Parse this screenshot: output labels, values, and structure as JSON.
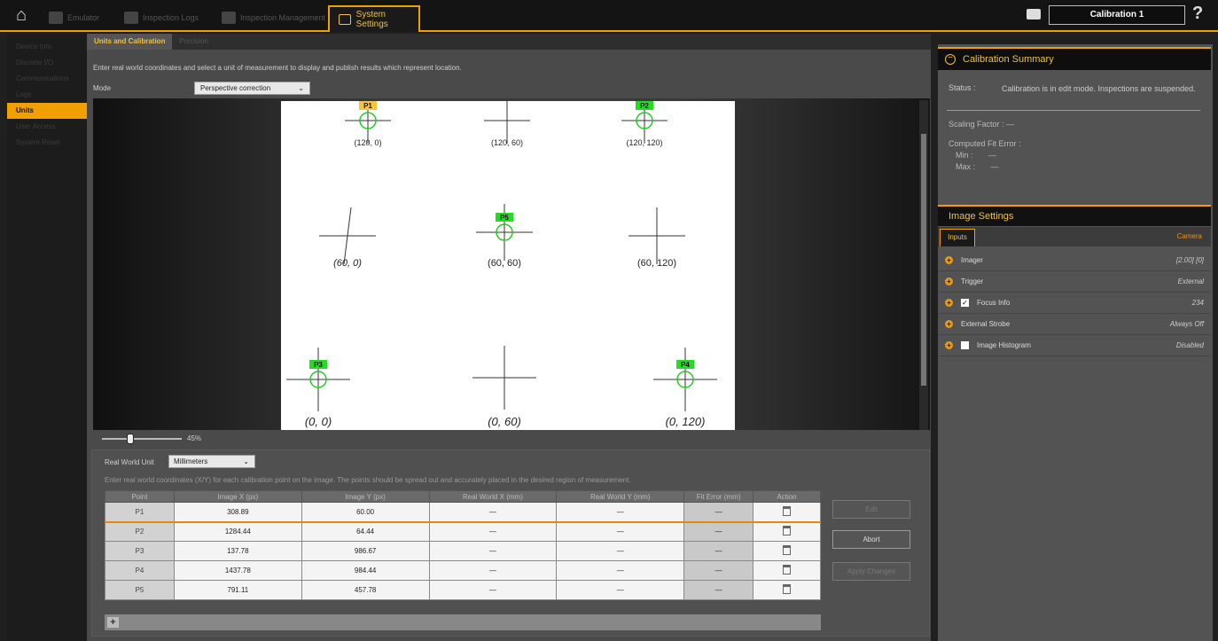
{
  "topbar": {
    "nav": [
      "Emulator",
      "Inspection Logs",
      "Inspection Management"
    ],
    "active_tab": "System Settings",
    "calibration_name": "Calibration 1",
    "help": "?"
  },
  "sidebar": {
    "items": [
      {
        "label": "Device Info"
      },
      {
        "label": "Discrete I/O"
      },
      {
        "label": "Communications"
      },
      {
        "label": "Logs"
      },
      {
        "label": "Units"
      },
      {
        "label": "User Access"
      },
      {
        "label": "System Reset"
      }
    ]
  },
  "main": {
    "tabs": [
      "Units and Calibration",
      "Precision"
    ],
    "instruction": "Enter real world coordinates and select a unit of measurement to display and publish results which represent location.",
    "mode_label": "Mode",
    "mode_value": "Perspective correction",
    "zoom": "45%"
  },
  "calibration_image": {
    "markers": [
      {
        "tag": "P1",
        "coord": "(120, 0)",
        "tag_color": "#f5c542"
      },
      {
        "tag": "",
        "coord": "(120, 60)"
      },
      {
        "tag": "P2",
        "coord": "(120, 120)",
        "tag_color": "#22dd22"
      },
      {
        "tag": "",
        "coord": "(60, 0)"
      },
      {
        "tag": "P5",
        "coord": "(60, 60)",
        "tag_color": "#22dd22"
      },
      {
        "tag": "",
        "coord": "(60, 120)"
      },
      {
        "tag": "P3",
        "coord": "(0, 0)",
        "tag_color": "#22dd22"
      },
      {
        "tag": "",
        "coord": "(0, 60)"
      },
      {
        "tag": "P4",
        "coord": "(0, 120)",
        "tag_color": "#22dd22"
      }
    ]
  },
  "bottom": {
    "unit_label": "Real World Unit",
    "unit_value": "Millimeters",
    "instruction": "Enter real world coordinates (X/Y) for each calibration point on the image. The points should be spread out and accurately placed in the desired region of measurement.",
    "columns": [
      "Point",
      "Image X (px)",
      "Image Y (px)",
      "Real World X (mm)",
      "Real World Y (mm)",
      "Fit Error (mm)",
      "Action"
    ],
    "rows": [
      {
        "point": "P1",
        "ix": "308.89",
        "iy": "60.00",
        "rx": "—",
        "ry": "—",
        "fit": "—"
      },
      {
        "point": "P2",
        "ix": "1284.44",
        "iy": "64.44",
        "rx": "—",
        "ry": "—",
        "fit": "—"
      },
      {
        "point": "P3",
        "ix": "137.78",
        "iy": "986.67",
        "rx": "—",
        "ry": "—",
        "fit": "—"
      },
      {
        "point": "P4",
        "ix": "1437.78",
        "iy": "984.44",
        "rx": "—",
        "ry": "—",
        "fit": "—"
      },
      {
        "point": "P5",
        "ix": "791.11",
        "iy": "457.78",
        "rx": "—",
        "ry": "—",
        "fit": "—"
      }
    ],
    "add_button": "+",
    "edit_button": "Edit",
    "abort_button": "Abort",
    "apply_button": "Apply Changes"
  },
  "calibration_summary": {
    "title": "Calibration Summary",
    "status_label": "Status :",
    "status_text": "Calibration is in edit mode. Inspections are suspended.",
    "scaling": "Scaling Factor : —",
    "fit_error_label": "Computed Fit Error :",
    "min": "Min :       —",
    "max": "Max :       —"
  },
  "image_settings": {
    "title": "Image Settings",
    "tab_inputs": "Inputs",
    "tab_camera": "Camera",
    "rows": [
      {
        "label": "Imager",
        "value": "[2.00] [0]",
        "checkbox": null
      },
      {
        "label": "Trigger",
        "value": "External",
        "checkbox": null
      },
      {
        "label": "Focus Info",
        "value": "234",
        "checkbox": true
      },
      {
        "label": "External Strobe",
        "value": "Always Off",
        "checkbox": null
      },
      {
        "label": "Image Histogram",
        "value": "Disabled",
        "checkbox": false
      }
    ]
  }
}
